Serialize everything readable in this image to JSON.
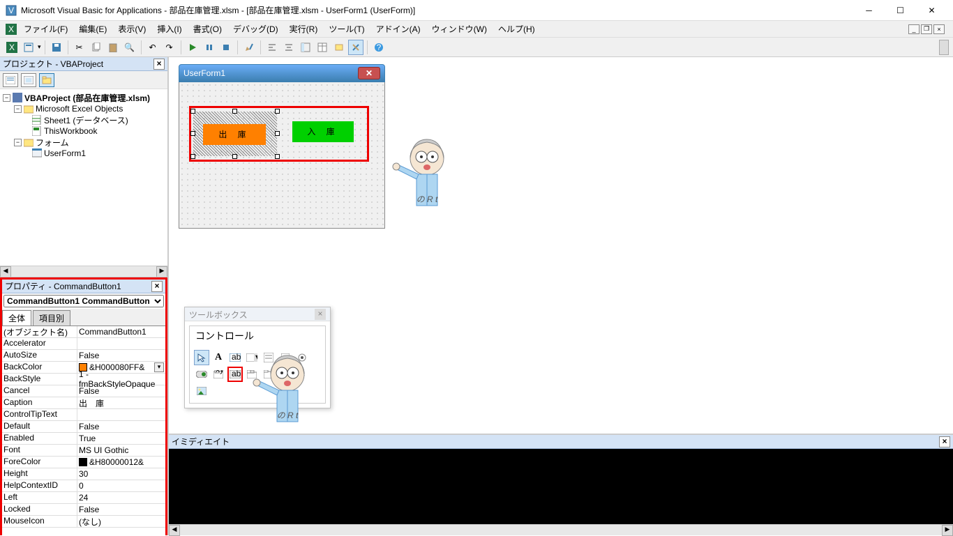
{
  "title": "Microsoft Visual Basic for Applications - 部品在庫管理.xlsm - [部品在庫管理.xlsm - UserForm1 (UserForm)]",
  "menu": {
    "file": "ファイル(F)",
    "edit": "編集(E)",
    "view": "表示(V)",
    "insert": "挿入(I)",
    "format": "書式(O)",
    "debug": "デバッグ(D)",
    "run": "実行(R)",
    "tools": "ツール(T)",
    "addin": "アドイン(A)",
    "window": "ウィンドウ(W)",
    "help": "ヘルプ(H)"
  },
  "project": {
    "title": "プロジェクト - VBAProject",
    "root": "VBAProject (部品在庫管理.xlsm)",
    "excel_objects": "Microsoft Excel Objects",
    "sheet1": "Sheet1 (データベース)",
    "thisworkbook": "ThisWorkbook",
    "forms": "フォーム",
    "userform1": "UserForm1"
  },
  "properties": {
    "title": "プロパティ - CommandButton1",
    "object": "CommandButton1 CommandButton",
    "tab_all": "全体",
    "tab_cat": "項目別",
    "rows": [
      {
        "name": "(オブジェクト名)",
        "val": "CommandButton1"
      },
      {
        "name": "Accelerator",
        "val": ""
      },
      {
        "name": "AutoSize",
        "val": "False"
      },
      {
        "name": "BackColor",
        "val": "&H000080FF&",
        "swatch": "orange",
        "dd": true
      },
      {
        "name": "BackStyle",
        "val": "1 - fmBackStyleOpaque"
      },
      {
        "name": "Cancel",
        "val": "False"
      },
      {
        "name": "Caption",
        "val": "出　庫"
      },
      {
        "name": "ControlTipText",
        "val": ""
      },
      {
        "name": "Default",
        "val": "False"
      },
      {
        "name": "Enabled",
        "val": "True"
      },
      {
        "name": "Font",
        "val": "MS UI Gothic"
      },
      {
        "name": "ForeColor",
        "val": "&H80000012&",
        "swatch": "black"
      },
      {
        "name": "Height",
        "val": "30"
      },
      {
        "name": "HelpContextID",
        "val": "0"
      },
      {
        "name": "Left",
        "val": "24"
      },
      {
        "name": "Locked",
        "val": "False"
      },
      {
        "name": "MouseIcon",
        "val": "(なし)"
      }
    ]
  },
  "form": {
    "title": "UserForm1",
    "btn1": "出 庫",
    "btn2": "入 庫"
  },
  "toolbox": {
    "title": "ツールボックス",
    "tab": "コントロール"
  },
  "immediate": {
    "title": "イミディエイト"
  }
}
